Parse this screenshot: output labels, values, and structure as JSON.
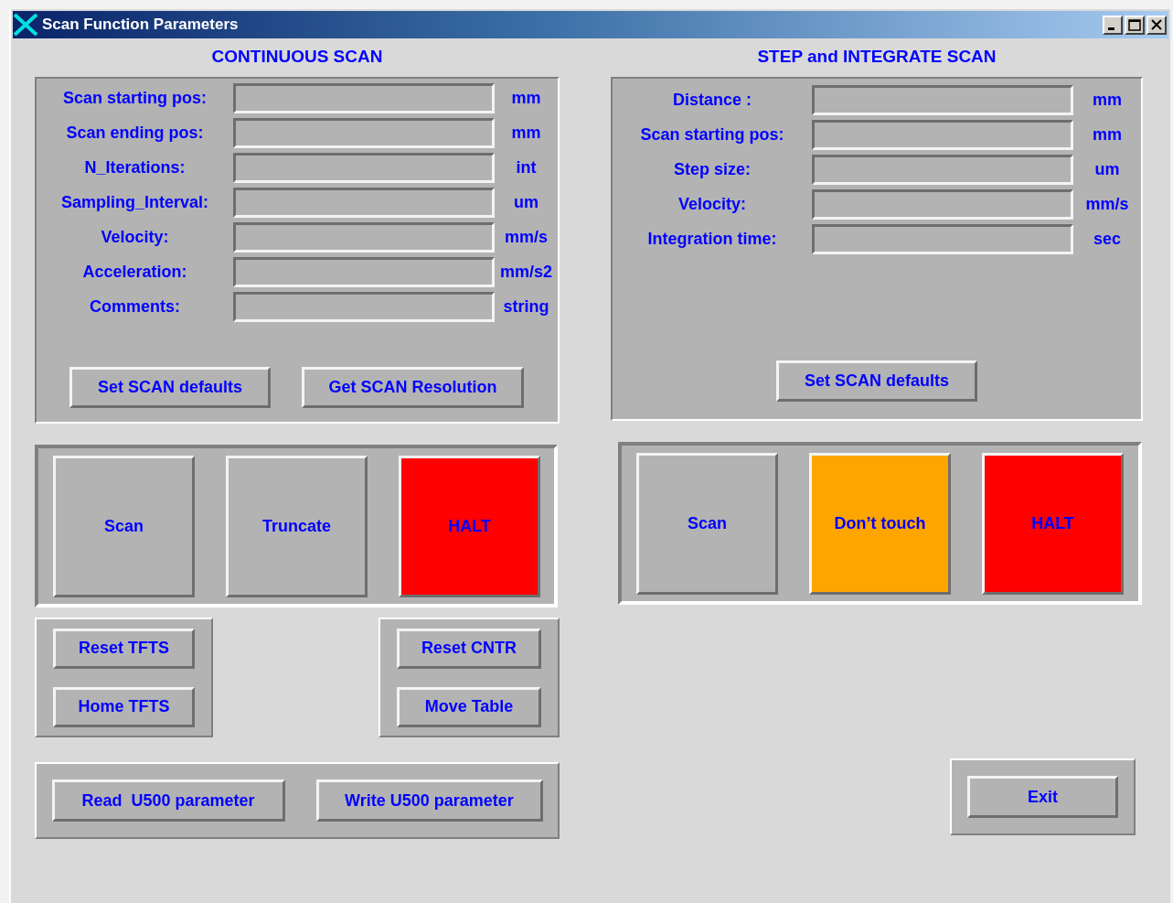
{
  "window": {
    "title": "Scan Function Parameters"
  },
  "continuous_scan": {
    "title": "CONTINUOUS SCAN",
    "fields": [
      {
        "label": "Scan starting pos:",
        "unit": "mm"
      },
      {
        "label": "Scan ending pos:",
        "unit": "mm"
      },
      {
        "label": "N_Iterations:",
        "unit": "int"
      },
      {
        "label": "Sampling_Interval:",
        "unit": "um"
      },
      {
        "label": "Velocity:",
        "unit": "mm/s"
      },
      {
        "label": "Acceleration:",
        "unit": "mm/s2"
      },
      {
        "label": "Comments:",
        "unit": "string"
      }
    ],
    "buttons": [
      "Set SCAN defaults",
      "Get SCAN Resolution"
    ],
    "actions": [
      {
        "label": "Scan",
        "color": "#b3b3b3"
      },
      {
        "label": "Truncate",
        "color": "#b3b3b3"
      },
      {
        "label": "HALT",
        "color": "#ff0000"
      }
    ],
    "tfts_buttons": [
      "Reset TFTS",
      "Home TFTS"
    ],
    "cntr_buttons": [
      "Reset CNTR",
      "Move Table"
    ],
    "u500_buttons": [
      "Read  U500 parameter",
      "Write U500 parameter"
    ]
  },
  "step_scan": {
    "title": "STEP and INTEGRATE SCAN",
    "fields": [
      {
        "label": "Distance :",
        "unit": "mm"
      },
      {
        "label": "Scan starting pos:",
        "unit": "mm"
      },
      {
        "label": "Step size:",
        "unit": "um"
      },
      {
        "label": "Velocity:",
        "unit": "mm/s"
      },
      {
        "label": "Integration time:",
        "unit": "sec"
      }
    ],
    "buttons": [
      "Set SCAN defaults"
    ],
    "actions": [
      {
        "label": "Scan",
        "color": "#b3b3b3"
      },
      {
        "label": "Don’t touch",
        "color": "#ffa500"
      },
      {
        "label": "HALT",
        "color": "#ff0000"
      }
    ]
  },
  "exit_button": "Exit"
}
